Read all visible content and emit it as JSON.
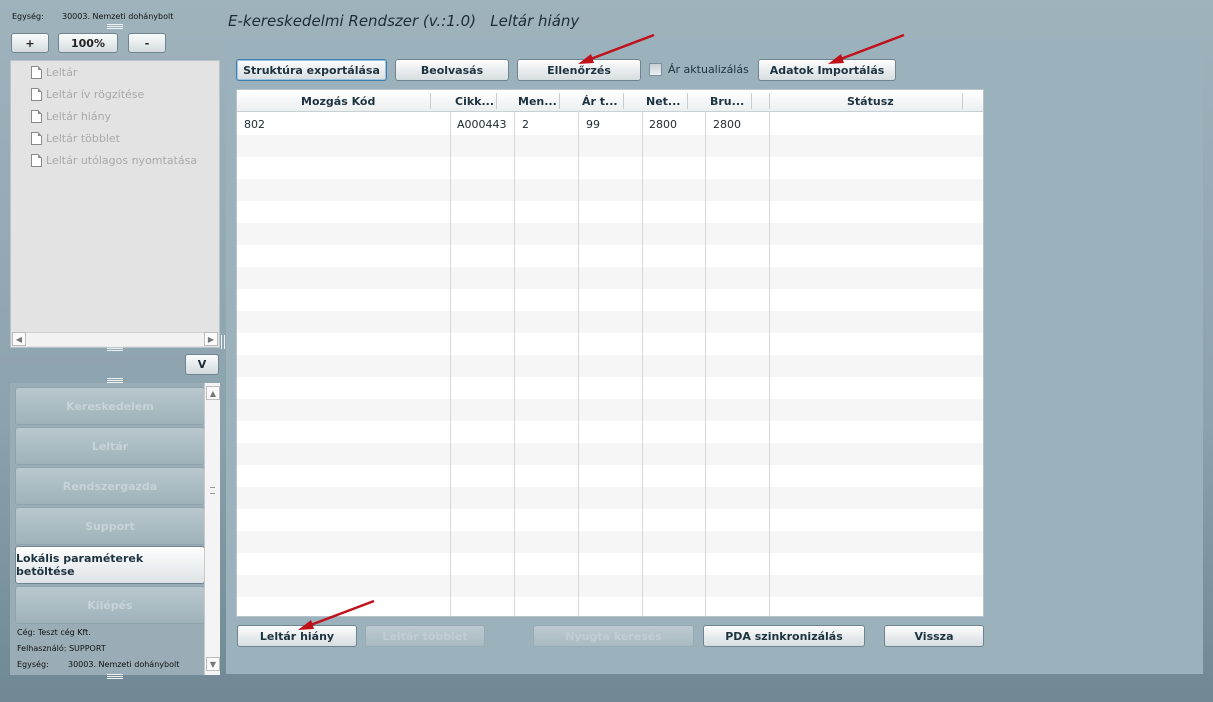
{
  "header": {
    "unit_label": "Egység:",
    "unit_value": "30003. Nemzeti dohánybolt",
    "app_title": "E-kereskedelmi Rendszer (v.:1.0)",
    "page_title": "Leltár hiány"
  },
  "zoom": {
    "plus": "+",
    "level": "100%",
    "minus": "-"
  },
  "tree": {
    "items": [
      {
        "label": "Leltár"
      },
      {
        "label": "Leltár ív rögzítése"
      },
      {
        "label": "Leltár hiány"
      },
      {
        "label": "Leltár többlet"
      },
      {
        "label": "Leltár utólagos nyomtatása"
      }
    ]
  },
  "collapse_button": "V",
  "menu": {
    "items": [
      {
        "label": "Kereskedelem"
      },
      {
        "label": "Leltár"
      },
      {
        "label": "Rendszergazda"
      },
      {
        "label": "Support"
      },
      {
        "label": "Lokális paraméterek betöltése"
      },
      {
        "label": "Kilépés"
      }
    ]
  },
  "footer": {
    "company": "Cég: Teszt cég Kft.",
    "user": "Felhasználó: SUPPORT",
    "unit_label": "Egység:",
    "unit_value": "30003. Nemzeti dohánybolt"
  },
  "toolbar": {
    "export_structure": "Struktúra exportálása",
    "read": "Beolvasás",
    "check": "Ellenőrzés",
    "price_update": "Ár aktualizálás",
    "import_data": "Adatok Importálás"
  },
  "table": {
    "columns": [
      "Mozgás Kód",
      "Cikk...",
      "Men...",
      "Ár t...",
      "Net...",
      "Bru...",
      "Státusz"
    ],
    "rows": [
      [
        "802",
        "A000443",
        "2",
        "99",
        "2800",
        "2800",
        ""
      ]
    ]
  },
  "bottom_buttons": {
    "shortage": "Leltár hiány",
    "surplus": "Leltár többlet",
    "receipt_search": "Nyugta keresés",
    "pda_sync": "PDA szinkronizálás",
    "back": "Vissza"
  },
  "colors": {
    "background": "#9fb3bd",
    "panel": "#9bb1bc",
    "arrow": "#c0101a",
    "focus": "#3d7fb0"
  }
}
